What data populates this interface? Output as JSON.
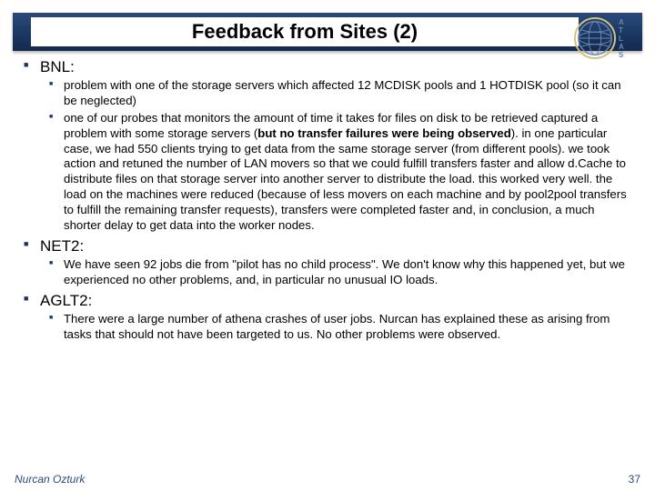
{
  "slide": {
    "title": "Feedback from Sites (2)",
    "logo_letters": [
      "A",
      "T",
      "L",
      "A",
      "S"
    ],
    "sections": [
      {
        "heading": "BNL:",
        "items": [
          {
            "text": "problem with one of the storage servers which affected 12 MCDISK pools and 1 HOTDISK pool (so it can be neglected)"
          },
          {
            "pre": "one of our probes that monitors the amount of time it takes for files on disk to be retrieved captured a problem with some storage servers (",
            "bold": "but no transfer failures were being observed",
            "post": "). in one particular case, we had 550 clients trying to get data from the same storage server (from different pools). we took action and retuned the number of LAN movers so that we could fulfill transfers faster and allow d.Cache to distribute files on that storage server into another server to distribute the load. this worked very well. the load on the machines were reduced (because of less movers on each machine and by pool2pool transfers to fulfill the remaining transfer requests), transfers were completed faster and, in conclusion, a much shorter delay to get data into the worker nodes."
          }
        ]
      },
      {
        "heading": "NET2:",
        "items": [
          {
            "text": "We have seen 92 jobs die from \"pilot has no child process\". We don't know why this happened yet, but we experienced no other problems, and, in particular no unusual IO loads."
          }
        ]
      },
      {
        "heading": "AGLT2:",
        "items": [
          {
            "text": "There were a large number of athena crashes of user jobs. Nurcan has explained these as arising from tasks that should not have been targeted to us. No other problems were observed."
          }
        ]
      }
    ],
    "footer": {
      "author": "Nurcan Ozturk",
      "page": "37"
    }
  }
}
